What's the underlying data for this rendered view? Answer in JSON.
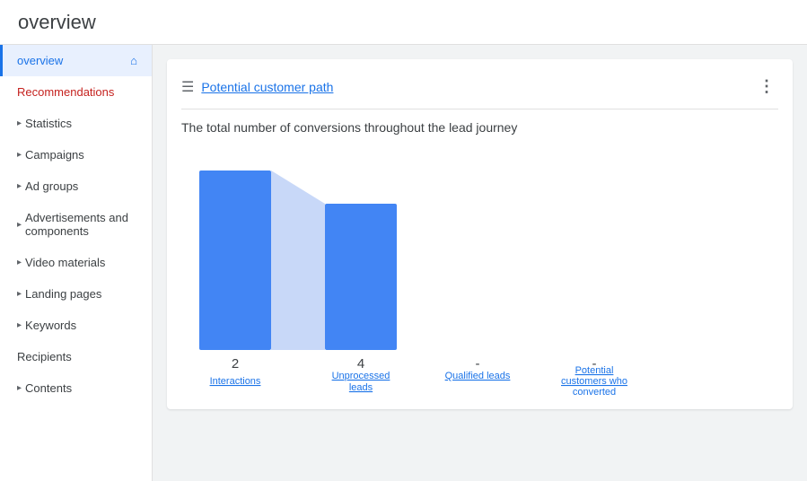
{
  "header": {
    "title": "overview"
  },
  "sidebar": {
    "items": [
      {
        "id": "overview",
        "label": "overview",
        "active": true,
        "has_home_icon": true,
        "has_chevron": false,
        "color": "active"
      },
      {
        "id": "recommendations",
        "label": "Recommendations",
        "active": false,
        "has_home_icon": false,
        "has_chevron": false,
        "color": "red"
      },
      {
        "id": "statistics",
        "label": "Statistics",
        "active": false,
        "has_home_icon": false,
        "has_chevron": true,
        "color": "normal"
      },
      {
        "id": "campaigns",
        "label": "Campaigns",
        "active": false,
        "has_home_icon": false,
        "has_chevron": true,
        "color": "normal"
      },
      {
        "id": "ad-groups",
        "label": "Ad groups",
        "active": false,
        "has_home_icon": false,
        "has_chevron": true,
        "color": "normal"
      },
      {
        "id": "advertisements",
        "label": "Advertisements and components",
        "active": false,
        "has_home_icon": false,
        "has_chevron": true,
        "color": "normal"
      },
      {
        "id": "video-materials",
        "label": "Video materials",
        "active": false,
        "has_home_icon": false,
        "has_chevron": true,
        "color": "normal"
      },
      {
        "id": "landing-pages",
        "label": "Landing pages",
        "active": false,
        "has_home_icon": false,
        "has_chevron": true,
        "color": "normal"
      },
      {
        "id": "keywords",
        "label": "Keywords",
        "active": false,
        "has_home_icon": false,
        "has_chevron": true,
        "color": "normal"
      },
      {
        "id": "recipients",
        "label": "Recipients",
        "active": false,
        "has_home_icon": false,
        "has_chevron": false,
        "color": "normal"
      },
      {
        "id": "contents",
        "label": "Contents",
        "active": false,
        "has_home_icon": false,
        "has_chevron": true,
        "color": "normal"
      }
    ]
  },
  "card": {
    "title": "Potential customer path",
    "description": "The total number of conversions throughout the lead journey",
    "more_icon": "⋮",
    "filter_icon": "≡",
    "columns": [
      {
        "id": "interactions",
        "label": "Interactions",
        "value": "2",
        "bar_height_pct": 100,
        "bar_type": "blue"
      },
      {
        "id": "unprocessed-leads",
        "label": "Unprocessed leads",
        "value": "4",
        "bar_height_pct": 62,
        "bar_type": "blue"
      },
      {
        "id": "qualified-leads",
        "label": "Qualified leads",
        "value": "-",
        "bar_height_pct": 0,
        "bar_type": "none"
      },
      {
        "id": "potential-customers",
        "label": "Potential customers who converted",
        "value": "-",
        "bar_height_pct": 0,
        "bar_type": "none"
      }
    ]
  }
}
